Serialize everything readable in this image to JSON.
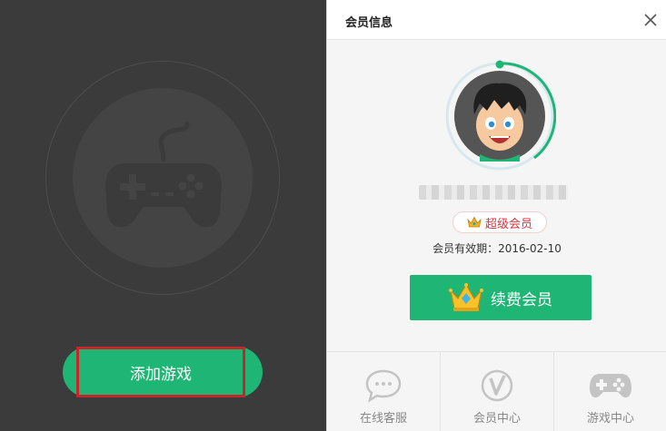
{
  "left": {
    "add_game_label": "添加游戏"
  },
  "panel": {
    "title": "会员信息",
    "vip_label": "超级会员",
    "expiry_text": "会员有效期：2016-02-10",
    "renew_label": "续费会员"
  },
  "nav": {
    "items": [
      {
        "label": "在线客服",
        "icon": "chat-bubble-icon"
      },
      {
        "label": "会员中心",
        "icon": "vip-v-icon"
      },
      {
        "label": "游戏中心",
        "icon": "gamepad-icon"
      }
    ]
  },
  "colors": {
    "brand_green": "#1fb574",
    "vip_red": "#e0323e",
    "dark_bg": "#3b3b3b",
    "highlight_border": "#c8252b"
  }
}
